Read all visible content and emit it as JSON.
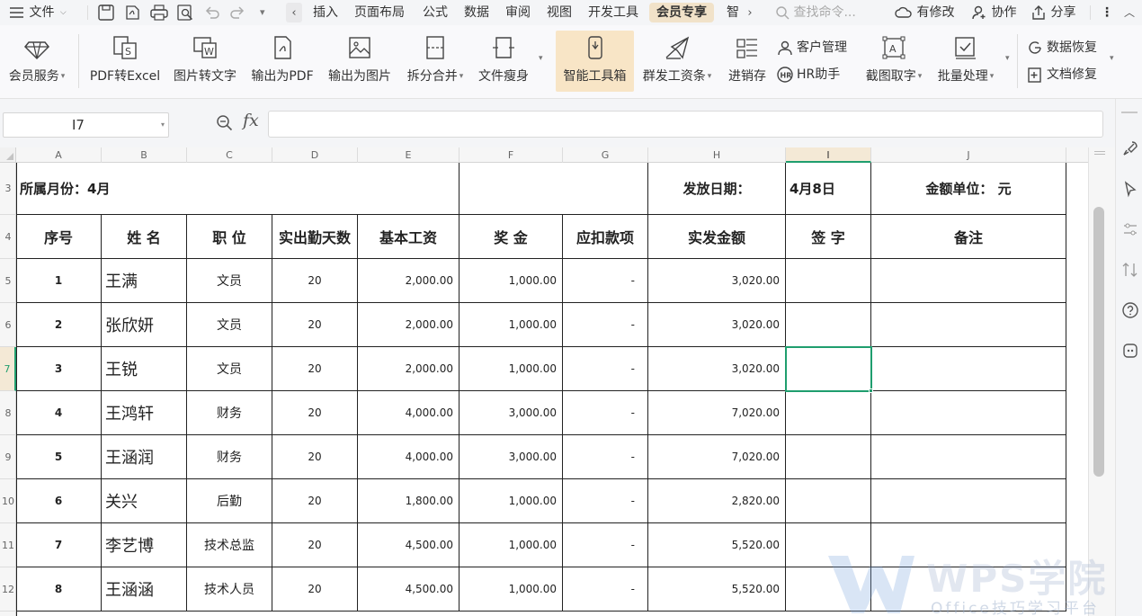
{
  "menubar": {
    "file_label": "文件",
    "tabs": [
      "插入",
      "页面布局",
      "公式",
      "数据",
      "审阅",
      "视图",
      "开发工具",
      "会员专享",
      "智"
    ],
    "active_tab": "会员专享",
    "search_placeholder": "查找命令...",
    "right": {
      "modified": "有修改",
      "collab": "协作",
      "share": "分享"
    }
  },
  "ribbon": {
    "items": [
      {
        "label": "会员服务",
        "dropdown": true
      },
      {
        "label": "PDF转Excel"
      },
      {
        "label": "图片转文字"
      },
      {
        "label": "输出为PDF"
      },
      {
        "label": "输出为图片"
      },
      {
        "label": "拆分合并",
        "dropdown": true
      },
      {
        "label": "文件瘦身"
      },
      {
        "label": "智能工具箱"
      },
      {
        "label": "群发工资条",
        "dropdown": true
      },
      {
        "label": "进销存"
      },
      {
        "label": "截图取字",
        "dropdown": true
      },
      {
        "label": "批量处理",
        "dropdown": true
      }
    ],
    "small": {
      "customer": "客户管理",
      "hr": "HR助手",
      "recover": "数据恢复",
      "repair": "文档修复"
    }
  },
  "formula_bar": {
    "name_box": "I7",
    "fx": "fx",
    "value": ""
  },
  "columns": [
    "A",
    "B",
    "C",
    "D",
    "E",
    "F",
    "G",
    "H",
    "I",
    "J"
  ],
  "rows": [
    "3",
    "4",
    "5",
    "6",
    "7",
    "8",
    "9",
    "10",
    "11",
    "12"
  ],
  "selected": {
    "col": "I",
    "row": "7"
  },
  "sheet": {
    "title_month": "所属月份：4月",
    "pay_date_label": "发放日期：",
    "pay_date": "4月8日",
    "unit_label": "金额单位：  元",
    "headers": [
      "序号",
      "姓  名",
      "职  位",
      "实出勤天数",
      "基本工资",
      "奖  金",
      "应扣款项",
      "实发金额",
      "签  字",
      "备注"
    ],
    "records": [
      [
        "1",
        "王满",
        "文员",
        "20",
        "2,000.00",
        "1,000.00",
        "-",
        "3,020.00",
        "",
        ""
      ],
      [
        "2",
        "张欣妍",
        "文员",
        "20",
        "2,000.00",
        "1,000.00",
        "-",
        "3,020.00",
        "",
        ""
      ],
      [
        "3",
        "王锐",
        "文员",
        "20",
        "2,000.00",
        "1,000.00",
        "-",
        "3,020.00",
        "",
        ""
      ],
      [
        "4",
        "王鸿轩",
        "财务",
        "20",
        "4,000.00",
        "3,000.00",
        "-",
        "7,020.00",
        "",
        ""
      ],
      [
        "5",
        "王涵润",
        "财务",
        "20",
        "4,000.00",
        "3,000.00",
        "-",
        "7,020.00",
        "",
        ""
      ],
      [
        "6",
        "关兴",
        "后勤",
        "20",
        "1,800.00",
        "1,000.00",
        "-",
        "2,820.00",
        "",
        ""
      ],
      [
        "7",
        "李艺博",
        "技术总监",
        "20",
        "4,500.00",
        "1,000.00",
        "-",
        "5,520.00",
        "",
        ""
      ],
      [
        "8",
        "王涵涵",
        "技术人员",
        "20",
        "4,500.00",
        "1,000.00",
        "-",
        "5,520.00",
        "",
        ""
      ]
    ]
  },
  "watermark": {
    "title": "WPS学院",
    "subtitle": "Office技巧学习平台"
  },
  "colors": {
    "accent": "#1f9e6e",
    "active_tab_bg": "#f1e2c9",
    "highlight_btn": "#f8e5c6"
  }
}
